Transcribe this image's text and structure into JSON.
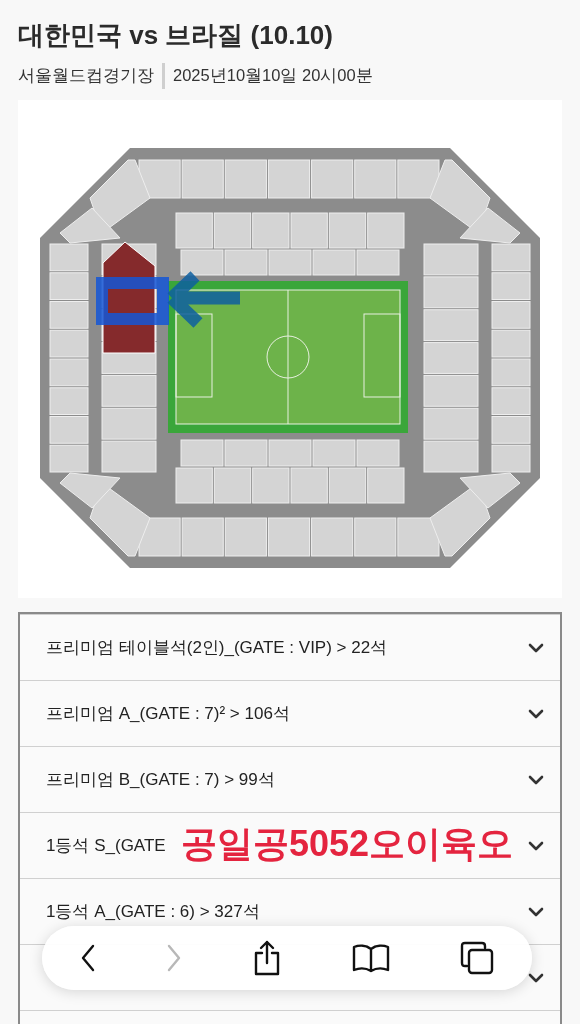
{
  "header": {
    "title": "대한민국 vs 브라질 (10.10)",
    "venue": "서울월드컵경기장",
    "datetime": "2025년10월10일 20시00분"
  },
  "seat_categories": [
    {
      "label": "프리미엄 테이블석(2인)_(GATE : VIP) > 22석",
      "expanded": false
    },
    {
      "label": "프리미엄 A_(GATE : 7)² > 106석",
      "expanded": false
    },
    {
      "label": "프리미엄 B_(GATE : 7) > 99석",
      "expanded": false
    },
    {
      "label": "1등석 S_(GATE",
      "expanded": false
    },
    {
      "label": "1등석 A_(GATE : 6) > 327석",
      "expanded": false
    },
    {
      "expanded": false
    }
  ],
  "overlay_text": "공일공5052오이육오",
  "toolbar": {
    "forward_disabled": true
  }
}
